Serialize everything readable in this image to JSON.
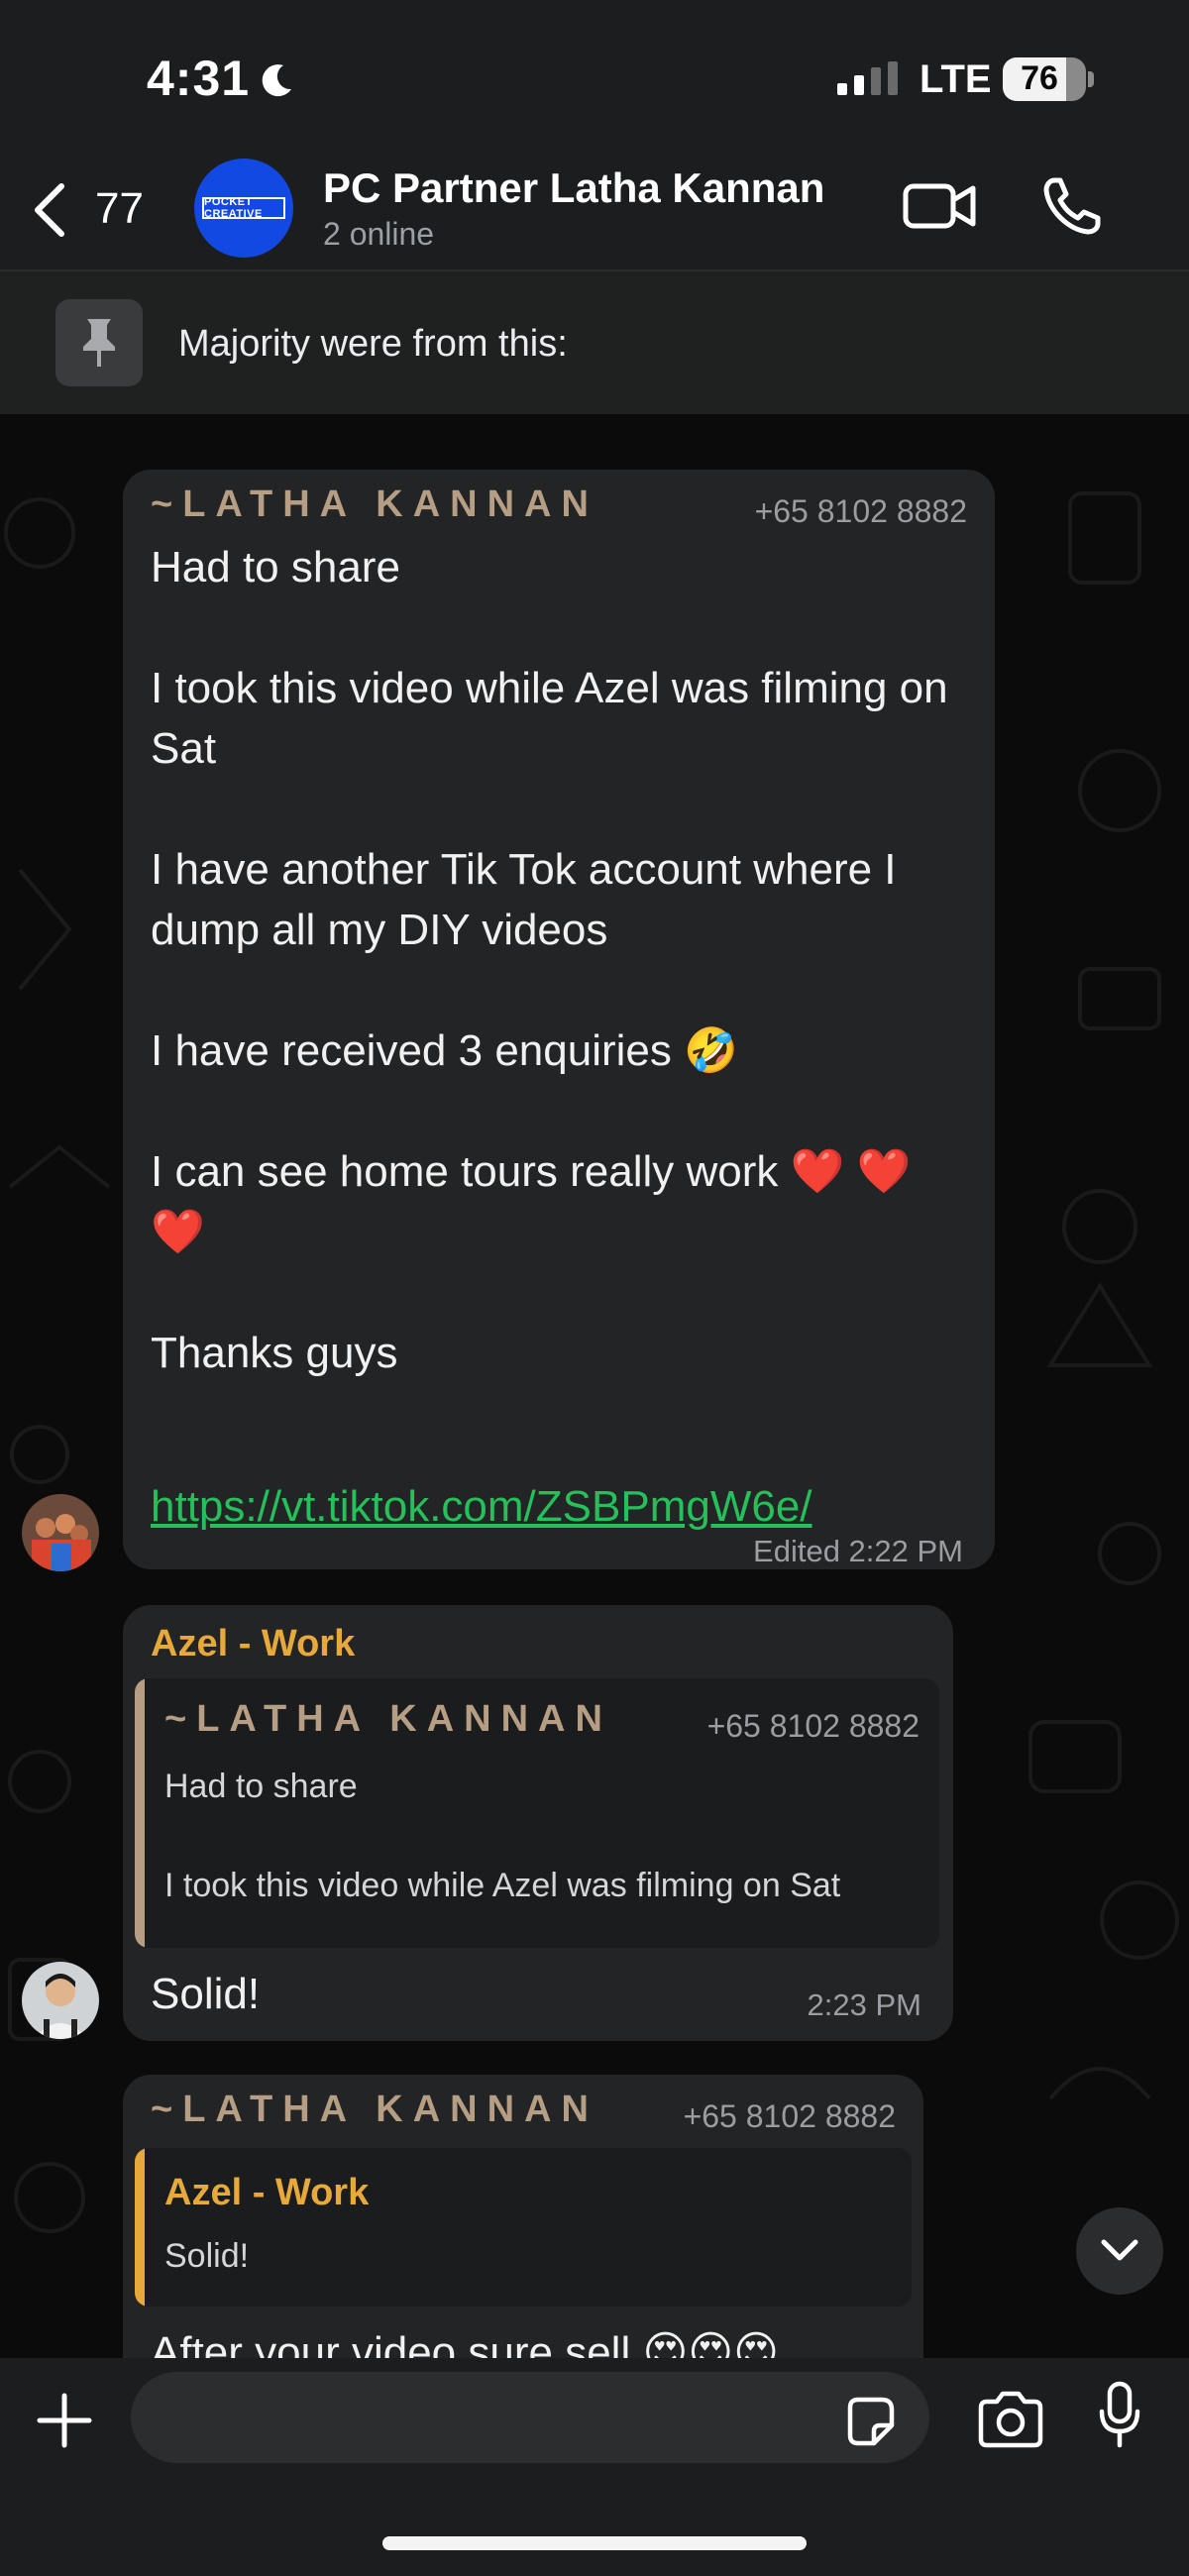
{
  "status_bar": {
    "time": "4:31",
    "network": "LTE",
    "battery": "76",
    "battery_level": 0.76
  },
  "header": {
    "back_count": "77",
    "group_avatar_text": "POCKET CREATIVE",
    "title": "PC Partner Latha Kannan",
    "subtitle": "2 online"
  },
  "pinned": {
    "text": "Majority were from this:"
  },
  "messages": [
    {
      "sender": "~LATHA KANNAN",
      "phone": "+65 8102 8882",
      "text": "Had to share\n\nI took this video while Azel was filming on Sat\n\nI have another Tik Tok account where I dump all my DIY videos\n\nI have received 3 enquiries 🤣\n\nI can see home tours really work ❤️ ❤️ ❤️\n\nThanks guys\n",
      "link": "https://vt.tiktok.com/ZSBPmgW6e/",
      "time": "Edited 2:22 PM"
    },
    {
      "sender": "Azel - Work",
      "quote_sender": "~LATHA KANNAN",
      "quote_phone": "+65 8102 8882",
      "quote_line1": "Had to share",
      "quote_line2": "I took this video while Azel was filming on Sat",
      "text": "Solid!",
      "time": "2:23 PM"
    },
    {
      "sender": "~LATHA KANNAN",
      "phone": "+65 8102 8882",
      "quote_sender": "Azel - Work",
      "quote_text": "Solid!",
      "text": "After your video sure sell 😍😍😍"
    }
  ],
  "composer": {
    "placeholder": ""
  },
  "colors": {
    "latha_name": "#b59e83",
    "azel_name": "#e8a93b",
    "link": "#25c05a",
    "bubble": "#232425",
    "header": "#1c1d1e"
  }
}
